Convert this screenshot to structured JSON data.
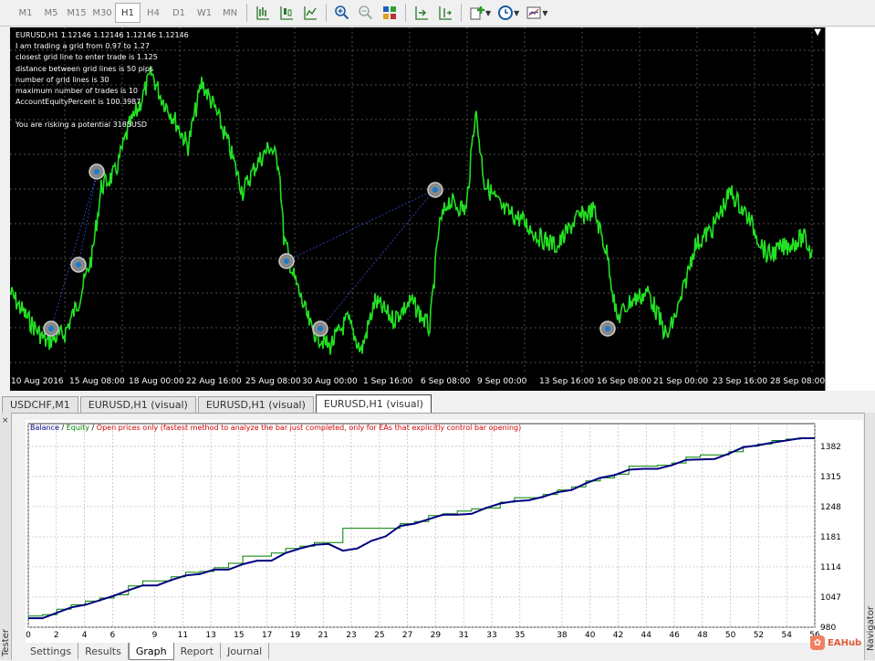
{
  "toolbar": {
    "timeframes": [
      "M1",
      "M5",
      "M15",
      "M30",
      "H1",
      "H4",
      "D1",
      "W1",
      "MN"
    ],
    "active_timeframe": "H1"
  },
  "chart": {
    "info_lines": [
      "EURUSD,H1  1.12146 1.12146 1.12146 1.12146",
      "I am trading a grid from 0.97 to 1.27",
      "closest grid line to enter trade is 1.125",
      "distance between grid lines is 50 pips",
      "number of grid lines is 30",
      "maximum number of trades is 10",
      "AccountEquityPercent is 100.3987",
      "",
      "You are risking a potential 3185USD"
    ],
    "close_glyph": "▼",
    "x_labels": [
      "10 Aug 2016",
      "15 Aug 08:00",
      "18 Aug 00:00",
      "22 Aug 16:00",
      "25 Aug 08:00",
      "30 Aug 00:00",
      "1 Sep 16:00",
      "6 Sep 08:00",
      "9 Sep 00:00",
      "13 Sep 16:00",
      "16 Sep 08:00",
      "21 Sep 00:00",
      "23 Sep 16:00",
      "28 Sep 08:00"
    ]
  },
  "chart_tabs": [
    {
      "label": "USDCHF,M1",
      "active": false
    },
    {
      "label": "EURUSD,H1 (visual)",
      "active": false
    },
    {
      "label": "EURUSD,H1 (visual)",
      "active": false
    },
    {
      "label": "EURUSD,H1 (visual)",
      "active": true
    }
  ],
  "tester": {
    "side_label": "Tester",
    "close_glyph": "×",
    "navigator_label": "Navigator",
    "legend": {
      "balance": "Balance",
      "sep1": " / ",
      "equity": "Equity",
      "sep2": " / ",
      "mode": "Open prices only (fastest method to analyze the bar just completed, only for EAs that explicitly control bar opening)"
    },
    "colors": {
      "balance": "#000080",
      "equity": "#008000",
      "mode": "#d00000"
    },
    "tabs": [
      {
        "label": "Settings",
        "active": false
      },
      {
        "label": "Results",
        "active": false
      },
      {
        "label": "Graph",
        "active": true
      },
      {
        "label": "Report",
        "active": false
      },
      {
        "label": "Journal",
        "active": false
      }
    ]
  },
  "watermark": {
    "text": "EAHub",
    "icon": "eahub-logo-icon"
  },
  "chart_data": {
    "type": "line",
    "y_ticks": [
      1382,
      1315,
      1248,
      1181,
      1114,
      1047,
      980
    ],
    "x_ticks": [
      0,
      2,
      4,
      6,
      9,
      11,
      13,
      15,
      17,
      19,
      21,
      23,
      25,
      27,
      29,
      31,
      33,
      35,
      38,
      40,
      42,
      44,
      46,
      48,
      50,
      52,
      54,
      56
    ],
    "ylim": [
      980,
      1400
    ],
    "series": [
      {
        "name": "Balance",
        "color": "#000080",
        "values": [
          1000,
          1000,
          1012,
          1024,
          1030,
          1040,
          1050,
          1062,
          1073,
          1073,
          1085,
          1095,
          1098,
          1108,
          1108,
          1120,
          1128,
          1128,
          1145,
          1155,
          1163,
          1165,
          1150,
          1155,
          1172,
          1182,
          1205,
          1210,
          1220,
          1230,
          1230,
          1232,
          1245,
          1255,
          1260,
          1262,
          1270,
          1280,
          1285,
          1300,
          1312,
          1318,
          1330,
          1332,
          1332,
          1340,
          1352,
          1353,
          1354,
          1366,
          1380,
          1384,
          1390,
          1395,
          1400,
          1400
        ]
      },
      {
        "name": "Equity",
        "color": "#008000",
        "values": [
          1005,
          1008,
          1020,
          1030,
          1038,
          1045,
          1052,
          1072,
          1083,
          1083,
          1092,
          1102,
          1104,
          1112,
          1122,
          1138,
          1138,
          1145,
          1155,
          1160,
          1168,
          1168,
          1200,
          1200,
          1200,
          1200,
          1210,
          1215,
          1228,
          1232,
          1238,
          1243,
          1245,
          1258,
          1268,
          1268,
          1275,
          1285,
          1292,
          1305,
          1312,
          1320,
          1338,
          1338,
          1340,
          1345,
          1358,
          1363,
          1363,
          1370,
          1382,
          1387,
          1395,
          1398,
          1400,
          1400
        ]
      }
    ]
  }
}
